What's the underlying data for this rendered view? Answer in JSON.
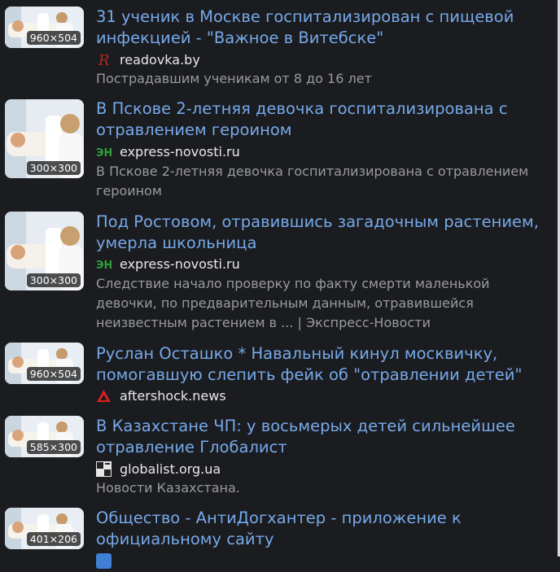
{
  "results": [
    {
      "title": "31 ученик в Москве госпитализирован с пищевой инфекцией - \"Важное в Витебске\"",
      "thumb_size": "960×504",
      "source": "readovka.by",
      "favicon": "readovka-icon",
      "snippet": "Пострадавшим ученикам от 8 до 16 лет"
    },
    {
      "title": "В Пскове 2-летняя девочка госпитализирована с отравлением героином",
      "thumb_size": "300×300",
      "source": "express-novosti.ru",
      "favicon": "express-novosti-icon",
      "snippet": "В Пскове 2-летняя девочка госпитализирована с отравлением героином"
    },
    {
      "title": "Под Ростовом, отравившись загадочным растением, умерла школьница",
      "thumb_size": "300×300",
      "source": "express-novosti.ru",
      "favicon": "express-novosti-icon",
      "snippet": "Следствие начало проверку по факту смерти маленькой девочки, по предварительным данным, отравившейся неизвестным растением в ... | Экспресс-Новости"
    },
    {
      "title": "Руслан Осташко * Навальный кинул москвичку, помогавшую слепить фейк об \"отравлении детей\"",
      "thumb_size": "960×504",
      "source": "aftershock.news",
      "favicon": "aftershock-icon",
      "snippet": ""
    },
    {
      "title": "В Казахстане ЧП: у восьмерых детей сильнейшее отравление Глобалист",
      "thumb_size": "585×300",
      "source": "globalist.org.ua",
      "favicon": "globalist-icon",
      "snippet": "Новости Казахстана."
    },
    {
      "title": "Общество - АнтиДогхантер - приложение к официальному сайту",
      "thumb_size": "401×206",
      "source": "",
      "favicon": "site-icon",
      "snippet": ""
    }
  ],
  "colors": {
    "background": "#1b1c1f",
    "link": "#76a9ea",
    "source": "#e9e9e9",
    "snippet": "#9a9ba0"
  }
}
